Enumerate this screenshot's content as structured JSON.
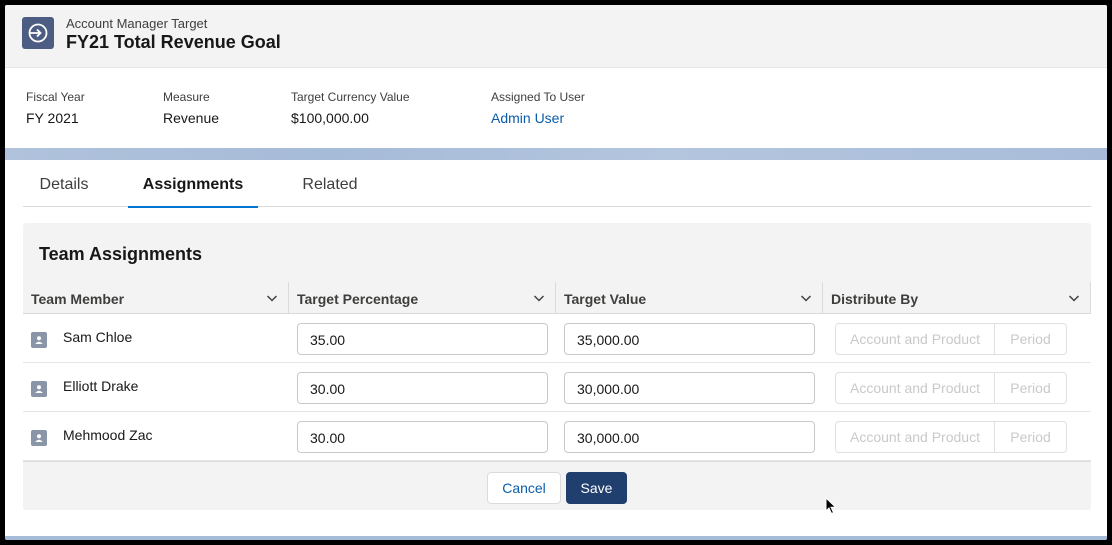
{
  "header": {
    "object_type": "Account Manager Target",
    "title": "FY21 Total Revenue Goal",
    "icon": "target-icon"
  },
  "highlights": [
    {
      "label": "Fiscal Year",
      "value": "FY 2021"
    },
    {
      "label": "Measure",
      "value": "Revenue"
    },
    {
      "label": "Target Currency Value",
      "value": "$100,000.00"
    },
    {
      "label": "Assigned To User",
      "value": "Admin User"
    }
  ],
  "tabs": [
    {
      "label": "Details",
      "active": false
    },
    {
      "label": "Assignments",
      "active": true
    },
    {
      "label": "Related",
      "active": false
    }
  ],
  "card": {
    "title": "Team Assignments",
    "columns": [
      "Team Member",
      "Target Percentage",
      "Target Value",
      "Distribute By"
    ],
    "rows": [
      {
        "member": "Sam Chloe",
        "percentage": "35.00",
        "value": "35,000.00",
        "distribute": [
          "Account and Product",
          "Period"
        ]
      },
      {
        "member": "Elliott Drake",
        "percentage": "30.00",
        "value": "30,000.00",
        "distribute": [
          "Account and Product",
          "Period"
        ]
      },
      {
        "member": "Mehmood Zac",
        "percentage": "30.00",
        "value": "30,000.00",
        "distribute": [
          "Account and Product",
          "Period"
        ]
      }
    ]
  },
  "actions": {
    "cancel_label": "Cancel",
    "save_label": "Save"
  },
  "colors": {
    "brand": "#0176d3",
    "save_button": "#203f6e",
    "link": "#0b5cab",
    "object_icon": "#4d5c82"
  }
}
